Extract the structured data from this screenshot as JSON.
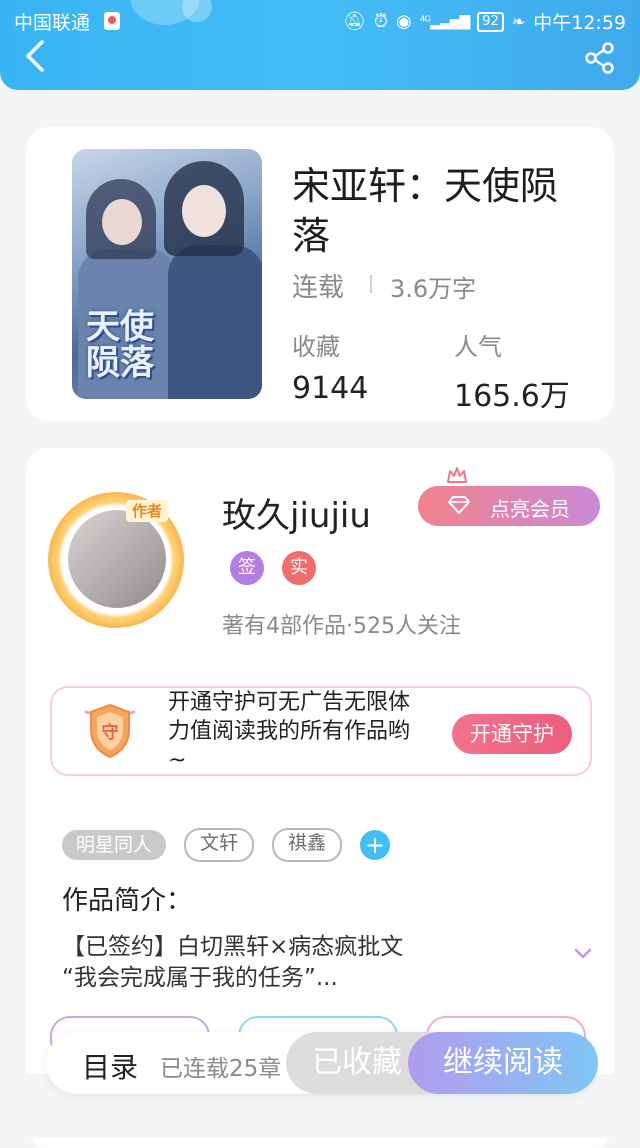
{
  "status_bar": {
    "carrier": "中国联通",
    "battery": "92",
    "time": "中午12:59",
    "icons": [
      "mute-icon",
      "alarm-icon",
      "eye-icon",
      "4g-signal-icon",
      "battery-icon",
      "leaf-icon"
    ]
  },
  "header": {
    "back_icon": "chevron-left-icon",
    "share_icon": "share-icon",
    "background": "#43bdf6"
  },
  "book": {
    "cover_title": "天使陨落",
    "title": "宋亚轩：天使陨落",
    "status": "连载",
    "word_count": "3.6万字",
    "favorites_label": "收藏",
    "favorites_value": "9144",
    "popularity_label": "人气",
    "popularity_value": "165.6万"
  },
  "author": {
    "tag": "作者",
    "name": "玫久jiujiu",
    "badge_signed": "签",
    "badge_real": "实",
    "meta": "著有4部作品·525人关注",
    "vip_button": "点亮会员"
  },
  "guard": {
    "shield_char": "守",
    "text": "开通守护可无广告无限体力值阅读我的所有作品哟~",
    "button": "开通守护"
  },
  "tags": {
    "filled": "明星同人",
    "outlined": [
      "文轩",
      "祺鑫"
    ],
    "add": "+"
  },
  "intro": {
    "title": "作品简介：",
    "line1": "【已签约】白切黑轩×病态疯批文",
    "line2": "“我会完成属于我的任务”..."
  },
  "bottom_bar": {
    "toc": "目录",
    "serial_status": "已连载25章",
    "favorite_button": "已收藏",
    "read_button": "继续阅读"
  },
  "colors": {
    "accent_blue": "#43bdf6",
    "vip_gradient_start": "#f3828c",
    "vip_gradient_end": "#c98ad6",
    "guard_button": "#ee5d7e",
    "badge_signed": "#b67ce0",
    "badge_real": "#ef6d6d"
  }
}
